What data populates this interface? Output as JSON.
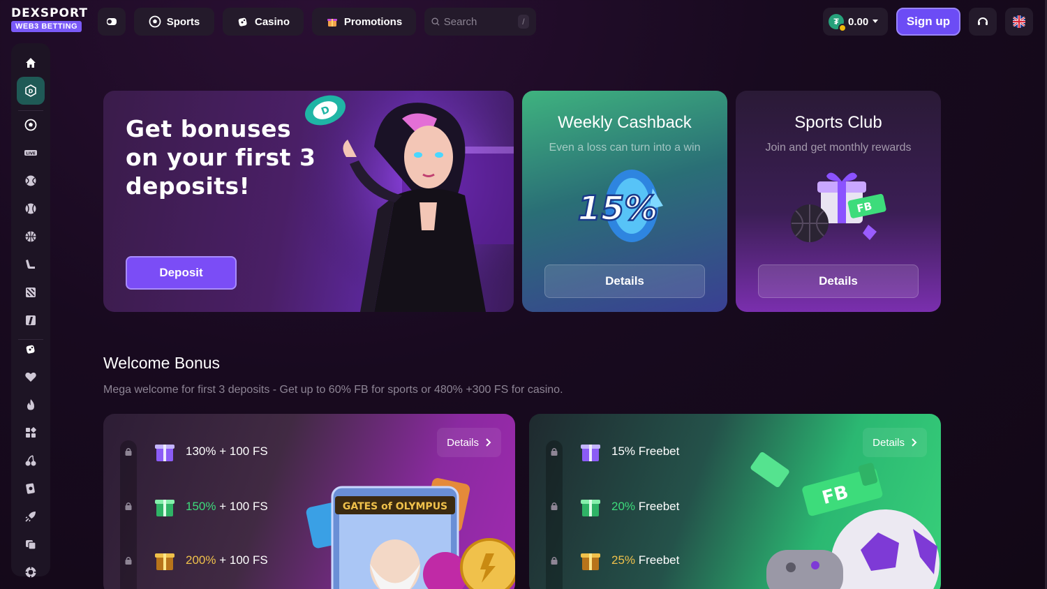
{
  "brand": {
    "name": "DEXSPORT",
    "tagline": "WEB3 BETTING"
  },
  "nav": {
    "sports": "Sports",
    "casino": "Casino",
    "promotions": "Promotions",
    "search_placeholder": "Search",
    "search_shortcut": "/"
  },
  "account": {
    "balance": "0.00",
    "signup": "Sign up"
  },
  "sidebar": {
    "items": [
      "home-icon",
      "dex-icon",
      "soccer-ball-icon",
      "live-icon",
      "tennis-ball-icon",
      "baseball-icon",
      "basketball-icon",
      "hockey-icon",
      "esports-icon",
      "mma-icon",
      "casino-dice-icon",
      "heart-icon",
      "fire-icon",
      "grid-icon",
      "cherries-icon",
      "card-icon",
      "rocket-icon",
      "table-games-icon",
      "chip-icon"
    ],
    "live_label": "LIVE"
  },
  "hero": {
    "title": "Get bonuses on your first 3 deposits!",
    "button": "Deposit"
  },
  "promos": {
    "cashback": {
      "title": "Weekly Cashback",
      "subtitle": "Even a loss can turn into a win",
      "badge": "15%",
      "button": "Details"
    },
    "club": {
      "title": "Sports Club",
      "subtitle": "Join and get monthly rewards",
      "badge": "FB",
      "button": "Details"
    }
  },
  "welcome": {
    "title": "Welcome Bonus",
    "subtitle": "Mega welcome for first 3 deposits - Get up to 60% FB for sports or 480% +300 FS for casino.",
    "casino": {
      "details": "Details",
      "tiers": [
        {
          "pct": "130%",
          "rest": " + 100 FS"
        },
        {
          "pct": "150%",
          "rest": " + 100 FS"
        },
        {
          "pct": "200%",
          "rest": " + 100 FS"
        }
      ],
      "game_logo": "GATES of OLYMPUS"
    },
    "sport": {
      "details": "Details",
      "tiers": [
        {
          "pct": "15%",
          "rest": " Freebet"
        },
        {
          "pct": "20%",
          "rest": " Freebet"
        },
        {
          "pct": "25%",
          "rest": " Freebet"
        }
      ],
      "badge": "FB"
    }
  },
  "colors": {
    "accent": "#6c4cf5",
    "green": "#3ddc7b",
    "gold": "#f0c14b",
    "sidebar_active": "#1f5a56"
  }
}
